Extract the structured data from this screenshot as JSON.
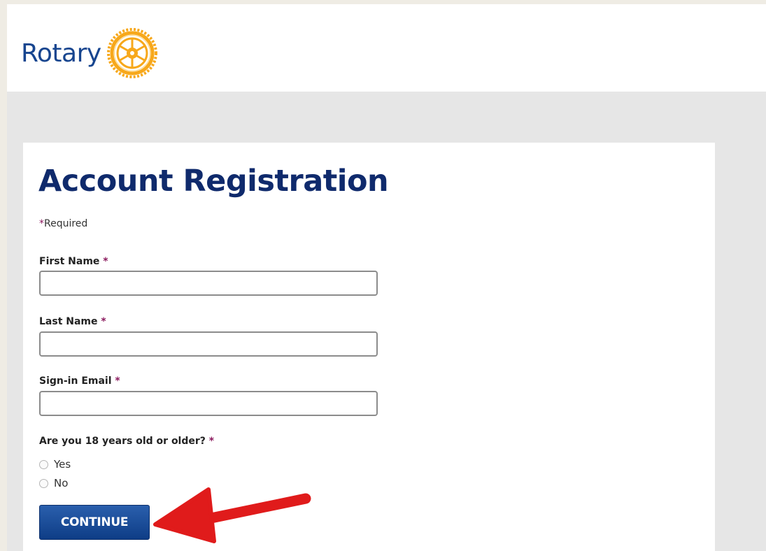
{
  "header": {
    "logo_text": "Rotary",
    "logo_icon": "rotary-wheel-emblem"
  },
  "form": {
    "title": "Account Registration",
    "required_asterisk": "*",
    "required_note": "Required",
    "fields": [
      {
        "label": "First Name",
        "asterisk": "*",
        "value": ""
      },
      {
        "label": "Last Name",
        "asterisk": "*",
        "value": ""
      },
      {
        "label": "Sign-in Email",
        "asterisk": "*",
        "value": ""
      }
    ],
    "age_question": {
      "label": "Are you 18 years old or older?",
      "asterisk": "*",
      "options": [
        "Yes",
        "No"
      ]
    },
    "continue_label": "CONTINUE"
  },
  "annotation": {
    "arrow_icon": "red-arrow-pointing-left",
    "color": "#e01b1b"
  },
  "colors": {
    "brand_blue": "#17458f",
    "title_navy": "#0f2a6c",
    "rotary_gold": "#f7a81b",
    "asterisk": "#8b1a5e"
  }
}
